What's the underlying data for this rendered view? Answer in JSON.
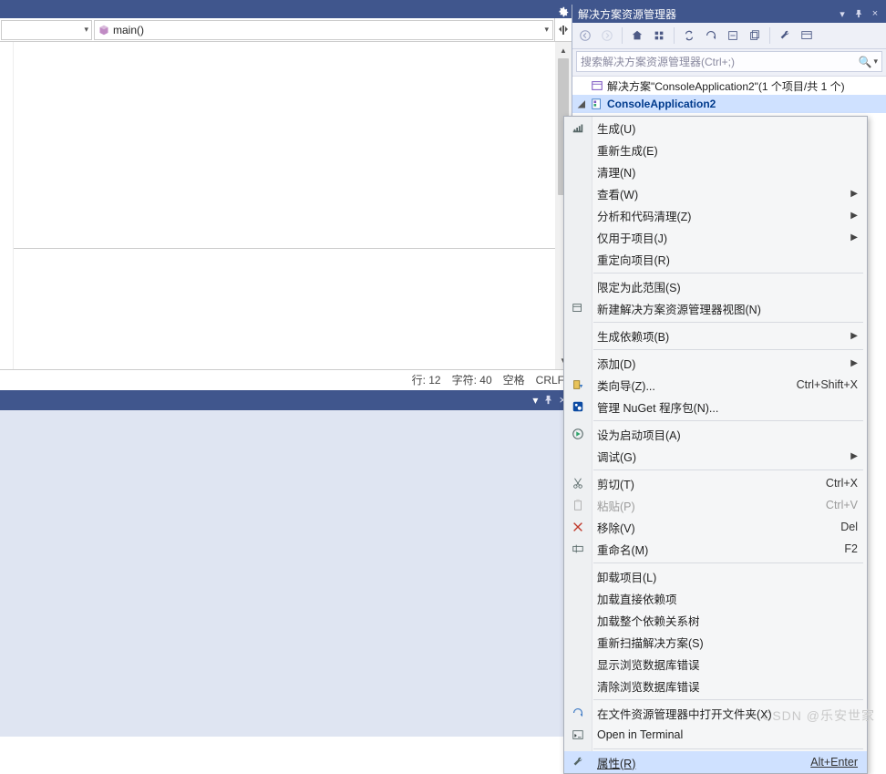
{
  "nav": {
    "scope_label": "main()"
  },
  "status": {
    "line": "行: 12",
    "col": "字符: 40",
    "ws": "空格",
    "eol": "CRLF"
  },
  "explorer": {
    "title": "解决方案资源管理器",
    "search_placeholder": "搜索解决方案资源管理器(Ctrl+;)",
    "solution": "解决方案\"ConsoleApplication2\"(1 个项目/共 1 个)",
    "project": "ConsoleApplication2"
  },
  "menu": [
    {
      "t": "item",
      "icon": "build",
      "label": "生成(U)"
    },
    {
      "t": "item",
      "label": "重新生成(E)"
    },
    {
      "t": "item",
      "label": "清理(N)"
    },
    {
      "t": "item",
      "label": "查看(W)",
      "sub": true
    },
    {
      "t": "item",
      "label": "分析和代码清理(Z)",
      "sub": true
    },
    {
      "t": "item",
      "label": "仅用于项目(J)",
      "sub": true
    },
    {
      "t": "item",
      "label": "重定向项目(R)"
    },
    {
      "t": "sep"
    },
    {
      "t": "item",
      "label": "限定为此范围(S)"
    },
    {
      "t": "item",
      "icon": "newview",
      "label": "新建解决方案资源管理器视图(N)"
    },
    {
      "t": "sep"
    },
    {
      "t": "item",
      "label": "生成依赖项(B)",
      "sub": true
    },
    {
      "t": "sep"
    },
    {
      "t": "item",
      "label": "添加(D)",
      "sub": true
    },
    {
      "t": "item",
      "icon": "classwiz",
      "label": "类向导(Z)...",
      "short": "Ctrl+Shift+X"
    },
    {
      "t": "item",
      "icon": "nuget",
      "label": "管理 NuGet 程序包(N)..."
    },
    {
      "t": "sep"
    },
    {
      "t": "item",
      "icon": "startup",
      "label": "设为启动项目(A)"
    },
    {
      "t": "item",
      "label": "调试(G)",
      "sub": true
    },
    {
      "t": "sep"
    },
    {
      "t": "item",
      "icon": "cut",
      "label": "剪切(T)",
      "short": "Ctrl+X"
    },
    {
      "t": "item",
      "icon": "paste",
      "label": "粘贴(P)",
      "short": "Ctrl+V",
      "disabled": true
    },
    {
      "t": "item",
      "icon": "remove",
      "label": "移除(V)",
      "short": "Del"
    },
    {
      "t": "item",
      "icon": "rename",
      "label": "重命名(M)",
      "short": "F2"
    },
    {
      "t": "sep"
    },
    {
      "t": "item",
      "label": "卸载项目(L)"
    },
    {
      "t": "item",
      "label": "加载直接依赖项"
    },
    {
      "t": "item",
      "label": "加载整个依赖关系树"
    },
    {
      "t": "item",
      "label": "重新扫描解决方案(S)"
    },
    {
      "t": "item",
      "label": "显示浏览数据库错误"
    },
    {
      "t": "item",
      "label": "清除浏览数据库错误"
    },
    {
      "t": "sep"
    },
    {
      "t": "item",
      "icon": "openfs",
      "label": "在文件资源管理器中打开文件夹(X)"
    },
    {
      "t": "item",
      "icon": "terminal",
      "label": "Open in Terminal"
    },
    {
      "t": "sep"
    },
    {
      "t": "item",
      "icon": "wrench",
      "label": "属性(R)",
      "short": "Alt+Enter",
      "hi": true
    }
  ],
  "watermark": "CSDN @乐安世家"
}
